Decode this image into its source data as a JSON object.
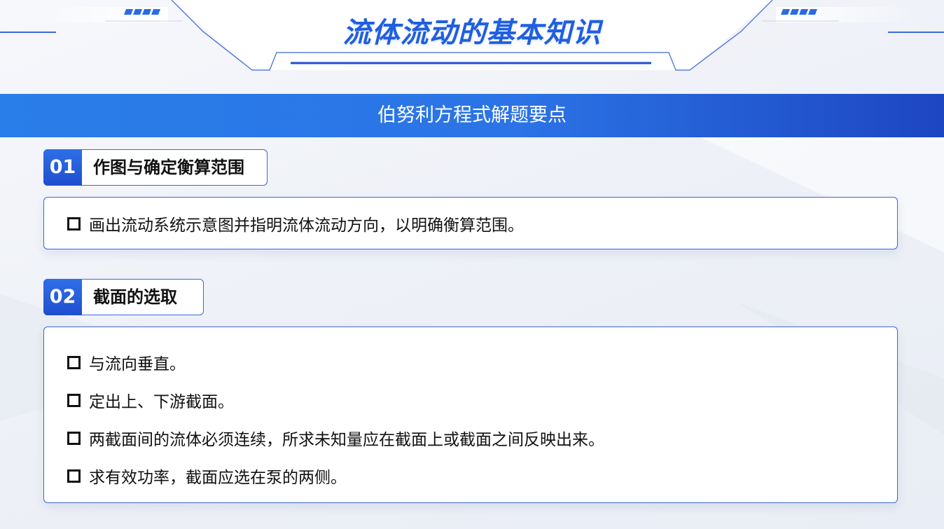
{
  "header": {
    "title": "流体流动的基本知识"
  },
  "banner": {
    "text": "伯努利方程式解题要点"
  },
  "sections": [
    {
      "number": "01",
      "title": "作图与确定衡算范围",
      "items": [
        "画出流动系统示意图并指明流体流动方向，以明确衡算范围。"
      ]
    },
    {
      "number": "02",
      "title": "截面的选取",
      "items": [
        "与流向垂直。",
        "定出上、下游截面。",
        "两截面间的流体必须连续，所求未知量应在截面上或截面之间反映出来。",
        "求有效功率，截面应选在泵的两侧。"
      ]
    }
  ],
  "icons": {
    "bullet": "square-bullet-icon"
  },
  "colors": {
    "accent": "#1f5fe0",
    "banner_start": "#2a7ee9",
    "banner_end": "#1d46c2",
    "border": "#3d67d8"
  }
}
